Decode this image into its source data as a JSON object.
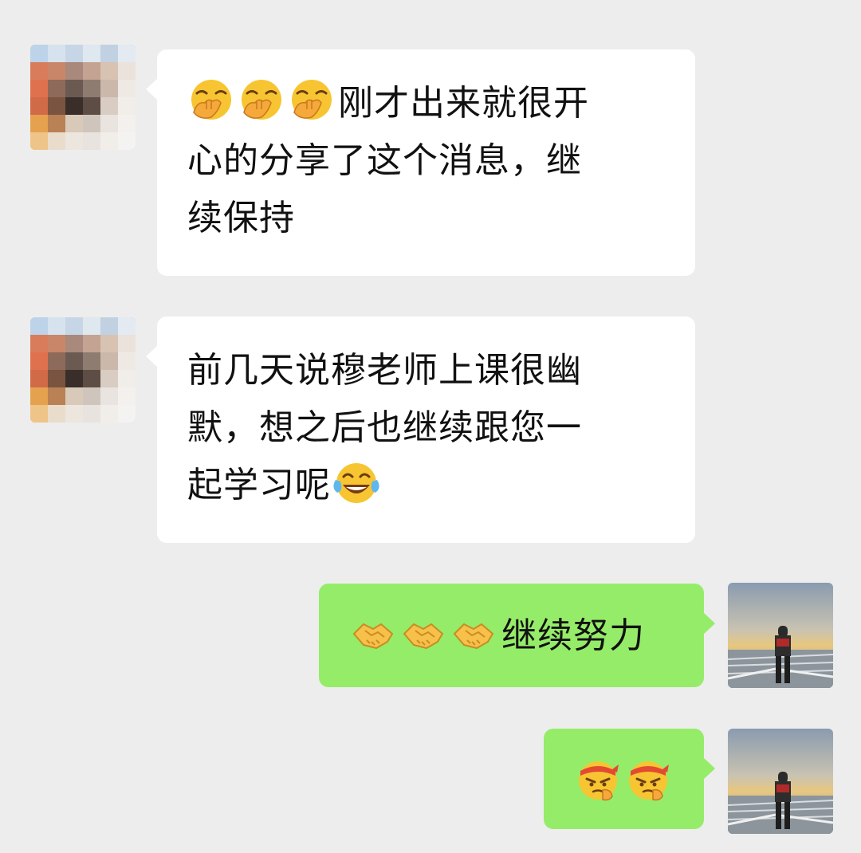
{
  "chat": {
    "messages": [
      {
        "side": "incoming",
        "avatar": "pixelated-contact-avatar",
        "emojis": [
          "face-with-hand-over-mouth-emoji",
          "face-with-hand-over-mouth-emoji",
          "face-with-hand-over-mouth-emoji"
        ],
        "lines": [
          "刚才出来就很开",
          "心的分享了这个消息，继",
          "续保持"
        ]
      },
      {
        "side": "incoming",
        "avatar": "pixelated-contact-avatar",
        "lines": [
          "前几天说穆老师上课很幽",
          "默，想之后也继续跟您一",
          "起学习呢"
        ],
        "trailing_emoji": "face-with-tears-of-joy-emoji"
      },
      {
        "side": "outgoing",
        "avatar": "self-avatar-boat-sunset",
        "emojis": [
          "handshake-emoji",
          "handshake-emoji",
          "handshake-emoji"
        ],
        "lines": [
          "继续努力"
        ]
      },
      {
        "side": "outgoing",
        "avatar": "self-avatar-boat-sunset",
        "emojis": [
          "determined-face-headband-emoji",
          "determined-face-headband-emoji"
        ],
        "lines": []
      }
    ]
  },
  "colors": {
    "background": "#ededed",
    "incoming_bubble": "#ffffff",
    "outgoing_bubble": "#95ec69",
    "text": "#111111"
  }
}
